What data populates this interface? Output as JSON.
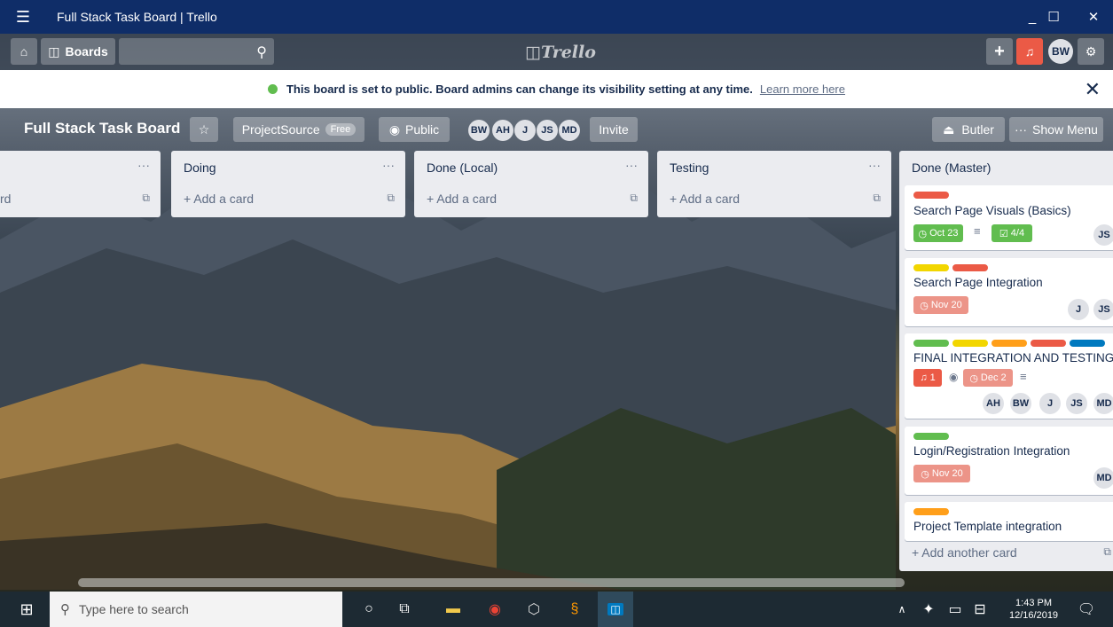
{
  "window": {
    "title": "Full Stack Task Board | Trello"
  },
  "header": {
    "boards_label": "Boards",
    "logo": "Trello",
    "avatar": "BW"
  },
  "notice": {
    "message": "This board is set to public. Board admins can change its visibility setting at any time.",
    "link": "Learn more here"
  },
  "board": {
    "name": "Full Stack Task Board",
    "team": "ProjectSource",
    "team_badge": "Free",
    "visibility": "Public",
    "members": [
      "BW",
      "AH",
      "J",
      "JS",
      "MD"
    ],
    "invite": "Invite",
    "butler": "Butler",
    "show_menu": "Show Menu"
  },
  "lists": [
    {
      "title": "",
      "add": "rd"
    },
    {
      "title": "Doing",
      "add": "+ Add a card"
    },
    {
      "title": "Done (Local)",
      "add": "+ Add a card"
    },
    {
      "title": "Testing",
      "add": "+ Add a card"
    },
    {
      "title": "Done (Master)",
      "add": "+ Add another card"
    }
  ],
  "cards": [
    {
      "title": "Search Page Visuals (Basics)",
      "due": "Oct 23",
      "checklist": "4/4",
      "members": [
        "JS"
      ]
    },
    {
      "title": "Search Page Integration",
      "due": "Nov 20",
      "members": [
        "J",
        "JS"
      ]
    },
    {
      "title": "FINAL INTEGRATION AND TESTING",
      "notifications": "1",
      "due": "Dec 2",
      "members": [
        "AH",
        "BW",
        "J",
        "JS",
        "MD"
      ]
    },
    {
      "title": "Login/Registration Integration",
      "due": "Nov 20",
      "members": [
        "MD"
      ]
    },
    {
      "title": "Project Template integration"
    }
  ],
  "colors": {
    "green": "#61bd4f",
    "yellow": "#f2d600",
    "orange": "#ff9f1a",
    "red": "#eb5a46",
    "blue": "#0079bf",
    "due_overdue": "#ec9488",
    "due_complete": "#61bd4f"
  },
  "taskbar": {
    "search_placeholder": "Type here to search",
    "time": "1:43 PM",
    "date": "12/16/2019"
  }
}
